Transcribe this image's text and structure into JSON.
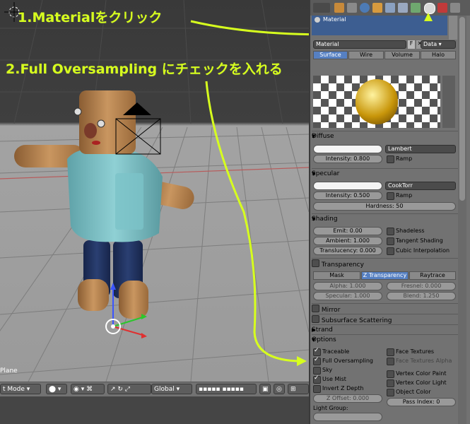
{
  "annotations": {
    "step1": "1.Materialをクリック",
    "step2": "2.Full Oversampling にチェックを入れる"
  },
  "viewport": {
    "object_name": "Plane",
    "header": {
      "mode": "t Mode",
      "orientation": "Global"
    }
  },
  "properties": {
    "context_icons": [
      "render-icon",
      "scene-icon",
      "world-icon",
      "object-icon",
      "constraint-icon",
      "modifier-icon",
      "data-icon",
      "material-icon",
      "texture-icon",
      "particles-icon"
    ],
    "slot_name": "Material",
    "material_name": "Material",
    "data_label": "Data",
    "tabs": [
      "Surface",
      "Wire",
      "Volume",
      "Halo"
    ],
    "active_tab": "Surface",
    "diffuse": {
      "title": "Diffuse",
      "shader": "Lambert",
      "intensity": "Intensity: 0.800",
      "ramp": "Ramp",
      "color": "#ffffff"
    },
    "specular": {
      "title": "Specular",
      "shader": "CookTorr",
      "intensity": "Intensity: 0.500",
      "ramp": "Ramp",
      "hardness": "Hardness: 50",
      "color": "#ffffff"
    },
    "shading": {
      "title": "Shading",
      "emit": "Emit: 0.00",
      "ambient": "Ambient: 1.000",
      "translucency": "Translucency: 0.000",
      "shadeless": "Shadeless",
      "tangent": "Tangent Shading",
      "cubic": "Cubic Interpolation"
    },
    "transparency": {
      "title": "Transparency",
      "modes": [
        "Mask",
        "Z Transparency",
        "Raytrace"
      ],
      "active_mode": "Z Transparency",
      "alpha": "Alpha: 1.000",
      "fresnel": "Fresnel: 0.000",
      "specular": "Specular: 1.000",
      "blend": "Blend: 1.250"
    },
    "collapsed": [
      "Mirror",
      "Subsurface Scattering",
      "Strand"
    ],
    "options": {
      "title": "Options",
      "traceable": "Traceable",
      "full_oversampling": "Full Oversampling",
      "sky": "Sky",
      "use_mist": "Use Mist",
      "invert_z": "Invert Z Depth",
      "z_offset": "Z Offset: 0.000",
      "light_group": "Light Group:",
      "face_textures": "Face Textures",
      "face_textures_alpha": "Face Textures Alpha",
      "vcol_paint": "Vertex Color Paint",
      "vcol_light": "Vertex Color Light",
      "object_color": "Object Color",
      "pass_index": "Pass Index: 0"
    }
  },
  "colors": {
    "annotation": "#d7ff1e",
    "accent": "#5680c2",
    "panel": "#727272"
  }
}
